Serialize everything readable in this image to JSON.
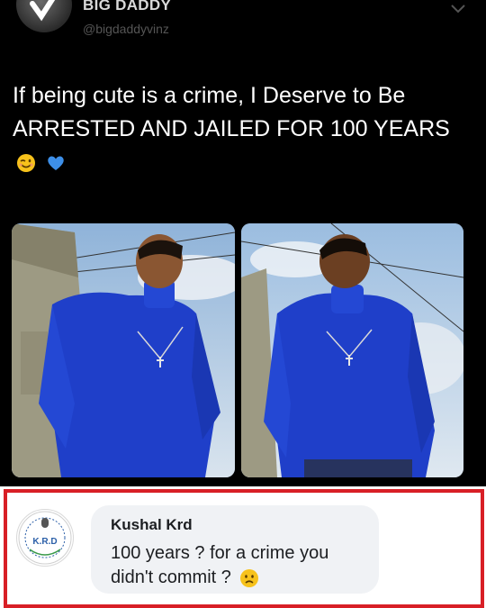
{
  "tweet": {
    "author_name": "BIG DADDY",
    "author_handle": "@bigdaddyvinz",
    "text": "If being cute is a crime, I Deserve to Be ARRESTED AND JAILED FOR 100 YEARS",
    "emojis": [
      "winking-face-emoji",
      "blue-heart-emoji"
    ],
    "photos": [
      "photo-man-blue-turtleneck-left",
      "photo-man-blue-turtleneck-right"
    ]
  },
  "comment": {
    "commenter_name": "Kushal Krd",
    "avatar_logo_text": "K.R.D",
    "text": "100 years ? for a crime you didn't commit ?",
    "emoji": "sad-face-emoji",
    "frame_color": "#d81f26"
  },
  "colors": {
    "tweet_background": "#000000",
    "shirt_blue": "#1f3fc9",
    "bubble_gray": "#f0f2f5"
  }
}
